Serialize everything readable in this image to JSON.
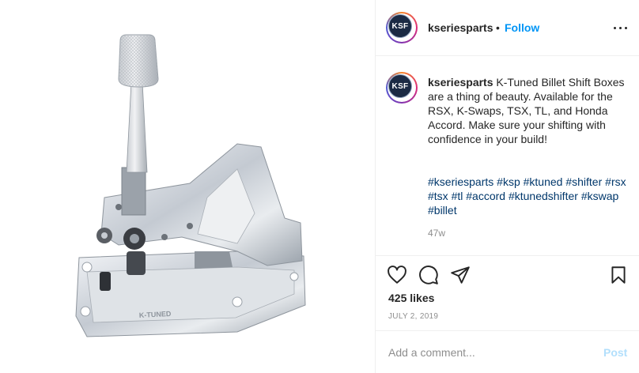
{
  "media": {
    "engraving": "K-TUNED"
  },
  "header": {
    "avatar_text": "KSF",
    "username": "kseriesparts",
    "separator": "•",
    "follow_label": "Follow",
    "more_icon": "more-horizontal-icon"
  },
  "caption": {
    "avatar_text": "KSF",
    "username": "kseriesparts",
    "text": "K-Tuned Billet Shift Boxes are a thing of beauty. Available for the RSX, K-Swaps, TSX, TL, and Honda Accord. Make sure your shifting with confidence in your build!",
    "hashtags": [
      "#kseriesparts",
      "#ksp",
      "#ktuned",
      "#shifter",
      "#rsx",
      "#tsx",
      "#tl",
      "#accord",
      "#ktunedshifter",
      "#kswap",
      "#billet"
    ],
    "time_ago": "47w"
  },
  "actions": {
    "like_icon": "heart-icon",
    "comment_icon": "comment-icon",
    "share_icon": "paper-plane-icon",
    "save_icon": "bookmark-icon"
  },
  "likes_text": "425 likes",
  "date_text": "JULY 2, 2019",
  "comment": {
    "placeholder": "Add a comment...",
    "post_label": "Post"
  },
  "colors": {
    "link_blue": "#0095f6",
    "hashtag_blue": "#00376b",
    "muted_gray": "#8e8e8e",
    "post_disabled": "#b2dffc",
    "text": "#262626"
  }
}
